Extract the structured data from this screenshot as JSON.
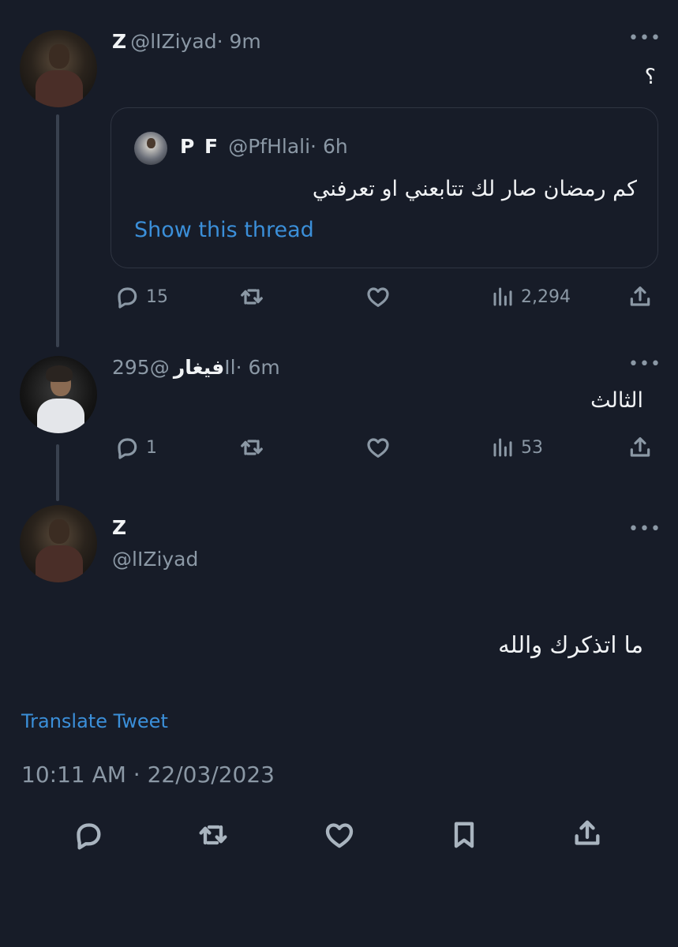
{
  "tweet1": {
    "name": "Z",
    "handle": "@lIZiyad",
    "time": "· 9m",
    "text": "؟",
    "quote": {
      "name": "P F",
      "handle": "@PfHlali",
      "time": "· 6h",
      "text": "كم رمضان صار لك تتابعني او تعرفني",
      "link": "Show this thread"
    },
    "replies": "15",
    "views": "2,294"
  },
  "tweet2": {
    "name": "فيغار",
    "handle": "@295Il",
    "time": "· 6m",
    "text": "الثالث",
    "replies": "1",
    "views": "53"
  },
  "tweet3": {
    "name": "Z",
    "handle": "@lIZiyad",
    "text": "ما اتذكرك والله",
    "translate": "Translate Tweet",
    "timestamp": "10:11 AM · 22/03/2023"
  },
  "icons": {
    "more": "more-icon",
    "reply": "reply-icon",
    "retweet": "retweet-icon",
    "like": "like-icon",
    "views": "views-icon",
    "share": "share-icon",
    "bookmark": "bookmark-icon"
  }
}
